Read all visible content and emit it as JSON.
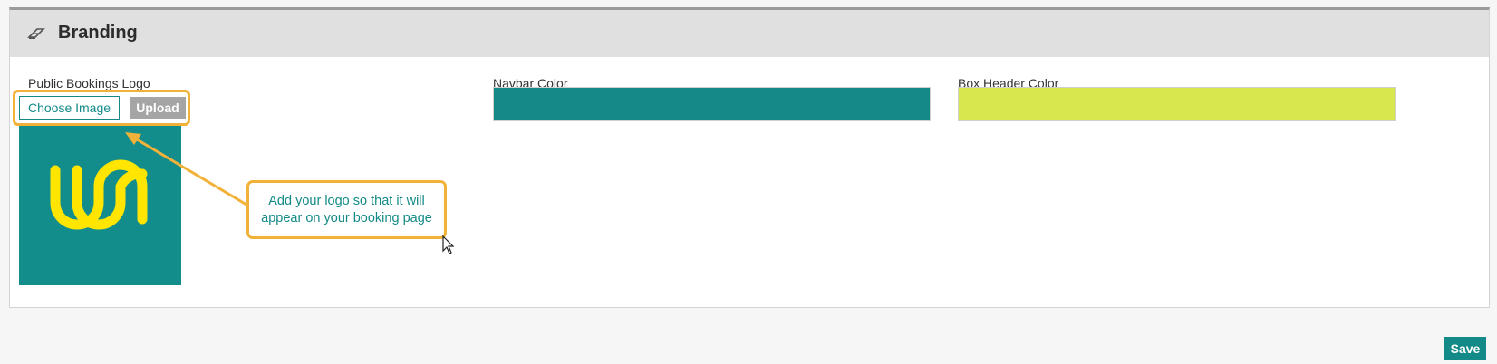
{
  "panel": {
    "title": "Branding",
    "icon": "eraser-icon"
  },
  "logo_field": {
    "label": "Public Bookings Logo",
    "choose_label": "Choose Image",
    "upload_label": "Upload"
  },
  "navbar_color": {
    "label": "Navbar Color",
    "value": "#138a87"
  },
  "box_header_color": {
    "label": "Box Header Color",
    "value": "#d6e84d"
  },
  "logo_colors": {
    "background": "#138d8b",
    "mark": "#ffe500"
  },
  "annotation": {
    "text": "Add your logo so that it will appear on your booking page",
    "highlight_color": "#f2b23a"
  },
  "footer": {
    "save_label": "Save"
  }
}
